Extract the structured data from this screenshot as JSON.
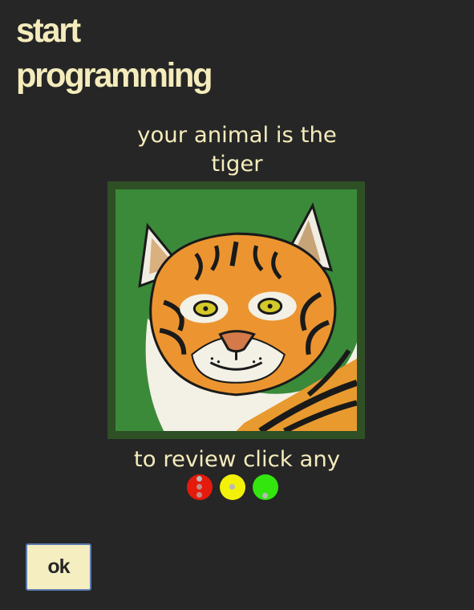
{
  "header": {
    "title_line1": "start",
    "title_line2": "programming"
  },
  "prompt": {
    "line1": "your animal is the",
    "line2": "tiger"
  },
  "animal": {
    "name": "tiger",
    "icon": "tiger-portrait"
  },
  "review": {
    "text": "to review click any"
  },
  "review_dots": [
    {
      "name": "red",
      "color": "#e41a0c"
    },
    {
      "name": "yellow",
      "color": "#f3f00a"
    },
    {
      "name": "green",
      "color": "#33e60e"
    }
  ],
  "footer": {
    "ok_label": "ok"
  },
  "colors": {
    "background": "#262626",
    "text": "#f5ecbc",
    "button_bg": "#f5eec0",
    "button_border": "#5a7bb0",
    "frame": "#2f4f25",
    "image_bg": "#3b8a3a"
  }
}
